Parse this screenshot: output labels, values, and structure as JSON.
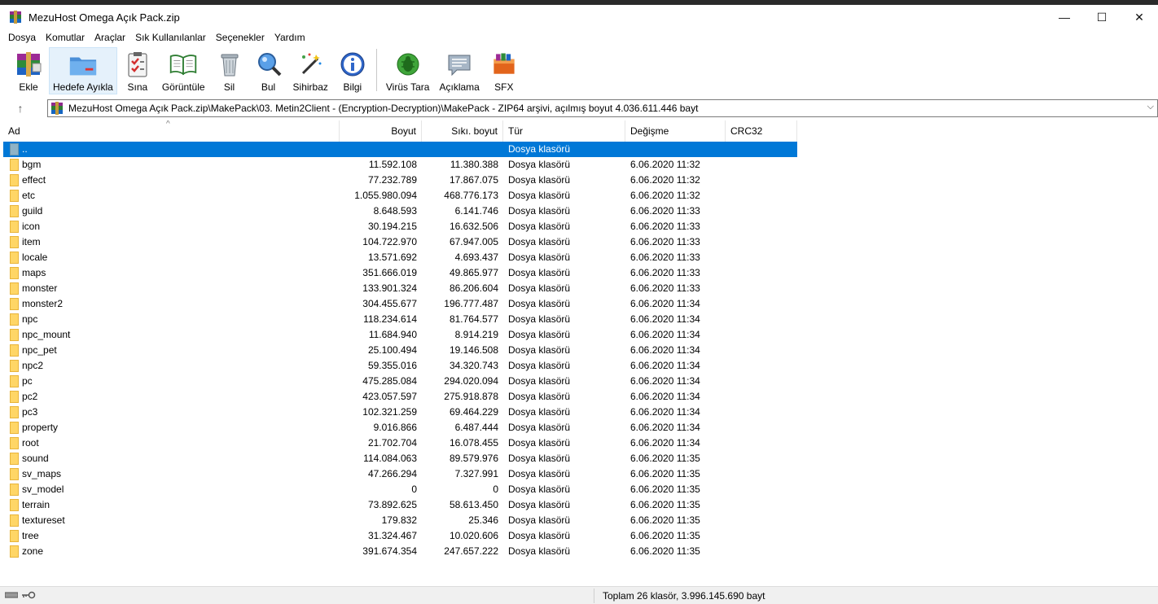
{
  "window": {
    "title": "MezuHost Omega Açık Pack.zip",
    "minimize": "—",
    "maximize": "☐",
    "close": "✕"
  },
  "menu": [
    "Dosya",
    "Komutlar",
    "Araçlar",
    "Sık Kullanılanlar",
    "Seçenekler",
    "Yardım"
  ],
  "toolbar": {
    "ekle": "Ekle",
    "hedefe": "Hedefe Ayıkla",
    "sina": "Sına",
    "goruntule": "Görüntüle",
    "sil": "Sil",
    "bul": "Bul",
    "sihirbaz": "Sihirbaz",
    "bilgi": "Bilgi",
    "virus": "Virüs Tara",
    "aciklama": "Açıklama",
    "sfx": "SFX"
  },
  "address": {
    "up": "↑",
    "path": "MezuHost Omega Açık Pack.zip\\MakePack\\03. Metin2Client - (Encryption-Decryption)\\MakePack - ZIP64 arşivi, açılmış boyut 4.036.611.446 bayt",
    "dropdown": "⌵"
  },
  "columns": {
    "name": "Ad",
    "size": "Boyut",
    "packed": "Sıkı. boyut",
    "type": "Tür",
    "modified": "Değişme",
    "crc": "CRC32",
    "sort_arrow": "^"
  },
  "parent_row": {
    "name": "..",
    "type": "Dosya klasörü"
  },
  "rows": [
    {
      "name": "bgm",
      "size": "11.592.108",
      "packed": "11.380.388",
      "type": "Dosya klasörü",
      "date": "6.06.2020 11:32"
    },
    {
      "name": "effect",
      "size": "77.232.789",
      "packed": "17.867.075",
      "type": "Dosya klasörü",
      "date": "6.06.2020 11:32"
    },
    {
      "name": "etc",
      "size": "1.055.980.094",
      "packed": "468.776.173",
      "type": "Dosya klasörü",
      "date": "6.06.2020 11:32"
    },
    {
      "name": "guild",
      "size": "8.648.593",
      "packed": "6.141.746",
      "type": "Dosya klasörü",
      "date": "6.06.2020 11:33"
    },
    {
      "name": "icon",
      "size": "30.194.215",
      "packed": "16.632.506",
      "type": "Dosya klasörü",
      "date": "6.06.2020 11:33"
    },
    {
      "name": "item",
      "size": "104.722.970",
      "packed": "67.947.005",
      "type": "Dosya klasörü",
      "date": "6.06.2020 11:33"
    },
    {
      "name": "locale",
      "size": "13.571.692",
      "packed": "4.693.437",
      "type": "Dosya klasörü",
      "date": "6.06.2020 11:33"
    },
    {
      "name": "maps",
      "size": "351.666.019",
      "packed": "49.865.977",
      "type": "Dosya klasörü",
      "date": "6.06.2020 11:33"
    },
    {
      "name": "monster",
      "size": "133.901.324",
      "packed": "86.206.604",
      "type": "Dosya klasörü",
      "date": "6.06.2020 11:33"
    },
    {
      "name": "monster2",
      "size": "304.455.677",
      "packed": "196.777.487",
      "type": "Dosya klasörü",
      "date": "6.06.2020 11:34"
    },
    {
      "name": "npc",
      "size": "118.234.614",
      "packed": "81.764.577",
      "type": "Dosya klasörü",
      "date": "6.06.2020 11:34"
    },
    {
      "name": "npc_mount",
      "size": "11.684.940",
      "packed": "8.914.219",
      "type": "Dosya klasörü",
      "date": "6.06.2020 11:34"
    },
    {
      "name": "npc_pet",
      "size": "25.100.494",
      "packed": "19.146.508",
      "type": "Dosya klasörü",
      "date": "6.06.2020 11:34"
    },
    {
      "name": "npc2",
      "size": "59.355.016",
      "packed": "34.320.743",
      "type": "Dosya klasörü",
      "date": "6.06.2020 11:34"
    },
    {
      "name": "pc",
      "size": "475.285.084",
      "packed": "294.020.094",
      "type": "Dosya klasörü",
      "date": "6.06.2020 11:34"
    },
    {
      "name": "pc2",
      "size": "423.057.597",
      "packed": "275.918.878",
      "type": "Dosya klasörü",
      "date": "6.06.2020 11:34"
    },
    {
      "name": "pc3",
      "size": "102.321.259",
      "packed": "69.464.229",
      "type": "Dosya klasörü",
      "date": "6.06.2020 11:34"
    },
    {
      "name": "property",
      "size": "9.016.866",
      "packed": "6.487.444",
      "type": "Dosya klasörü",
      "date": "6.06.2020 11:34"
    },
    {
      "name": "root",
      "size": "21.702.704",
      "packed": "16.078.455",
      "type": "Dosya klasörü",
      "date": "6.06.2020 11:34"
    },
    {
      "name": "sound",
      "size": "114.084.063",
      "packed": "89.579.976",
      "type": "Dosya klasörü",
      "date": "6.06.2020 11:35"
    },
    {
      "name": "sv_maps",
      "size": "47.266.294",
      "packed": "7.327.991",
      "type": "Dosya klasörü",
      "date": "6.06.2020 11:35"
    },
    {
      "name": "sv_model",
      "size": "0",
      "packed": "0",
      "type": "Dosya klasörü",
      "date": "6.06.2020 11:35"
    },
    {
      "name": "terrain",
      "size": "73.892.625",
      "packed": "58.613.450",
      "type": "Dosya klasörü",
      "date": "6.06.2020 11:35"
    },
    {
      "name": "textureset",
      "size": "179.832",
      "packed": "25.346",
      "type": "Dosya klasörü",
      "date": "6.06.2020 11:35"
    },
    {
      "name": "tree",
      "size": "31.324.467",
      "packed": "10.020.606",
      "type": "Dosya klasörü",
      "date": "6.06.2020 11:35"
    },
    {
      "name": "zone",
      "size": "391.674.354",
      "packed": "247.657.222",
      "type": "Dosya klasörü",
      "date": "6.06.2020 11:35"
    }
  ],
  "status": {
    "summary": "Toplam 26 klasör, 3.996.145.690 bayt"
  },
  "colors": {
    "selection": "#0078d7",
    "folder": "#ffd666"
  }
}
